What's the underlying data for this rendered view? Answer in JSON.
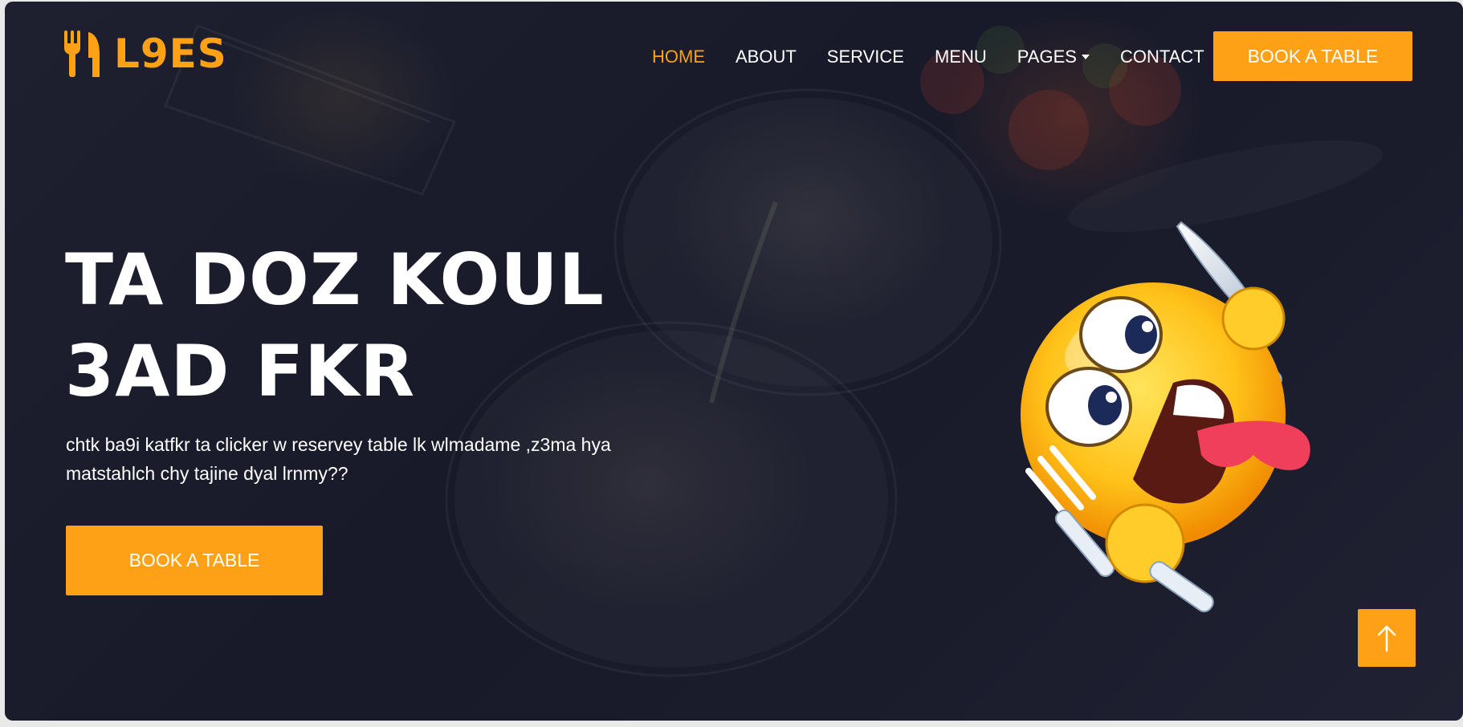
{
  "brand": {
    "name": "L9ES",
    "icon": "utensils-icon"
  },
  "nav": {
    "items": [
      {
        "label": "HOME",
        "active": true
      },
      {
        "label": "ABOUT"
      },
      {
        "label": "SERVICE"
      },
      {
        "label": "MENU"
      },
      {
        "label": "PAGES",
        "dropdown": true
      },
      {
        "label": "CONTACT"
      }
    ],
    "cta_label": "BOOK A TABLE"
  },
  "hero": {
    "title_line1": "TA DOZ KOUL",
    "title_line2": "3AD FKR",
    "subtitle": "chtk ba9i katfkr ta clicker w reservey table lk wlmadame ,z3ma hya matstahlch chy tajine dyal lrnmy??",
    "cta_label": "BOOK A TABLE",
    "image": "hungry-emoji-with-knife-and-fork"
  },
  "back_to_top": {
    "icon": "arrow-up-icon"
  },
  "colors": {
    "accent": "#fea116",
    "background": "#1a1c2c",
    "text": "#ffffff"
  }
}
